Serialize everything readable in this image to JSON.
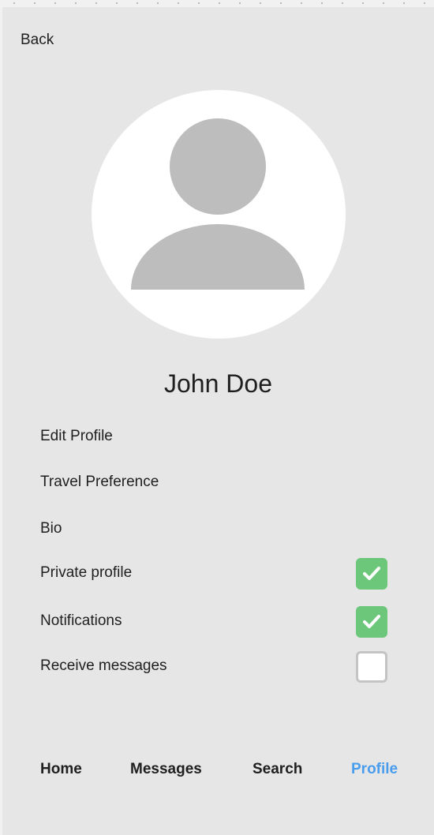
{
  "nav": {
    "back_label": "Back"
  },
  "profile": {
    "name": "John Doe"
  },
  "menu": {
    "edit_profile": "Edit Profile",
    "travel_preference": "Travel Preference",
    "bio": "Bio"
  },
  "settings": [
    {
      "label": "Private profile",
      "checked": true
    },
    {
      "label": "Notifications",
      "checked": true
    },
    {
      "label": "Receive messages",
      "checked": false
    }
  ],
  "tabbar": {
    "home": "Home",
    "messages": "Messages",
    "search": "Search",
    "profile": "Profile",
    "active": "profile"
  },
  "icons": {
    "avatar": "person-placeholder-icon",
    "check": "checkmark-icon"
  },
  "colors": {
    "checked": "#6cc77a",
    "active_tab": "#4a9ded",
    "avatar_figure": "#bdbdbd"
  }
}
